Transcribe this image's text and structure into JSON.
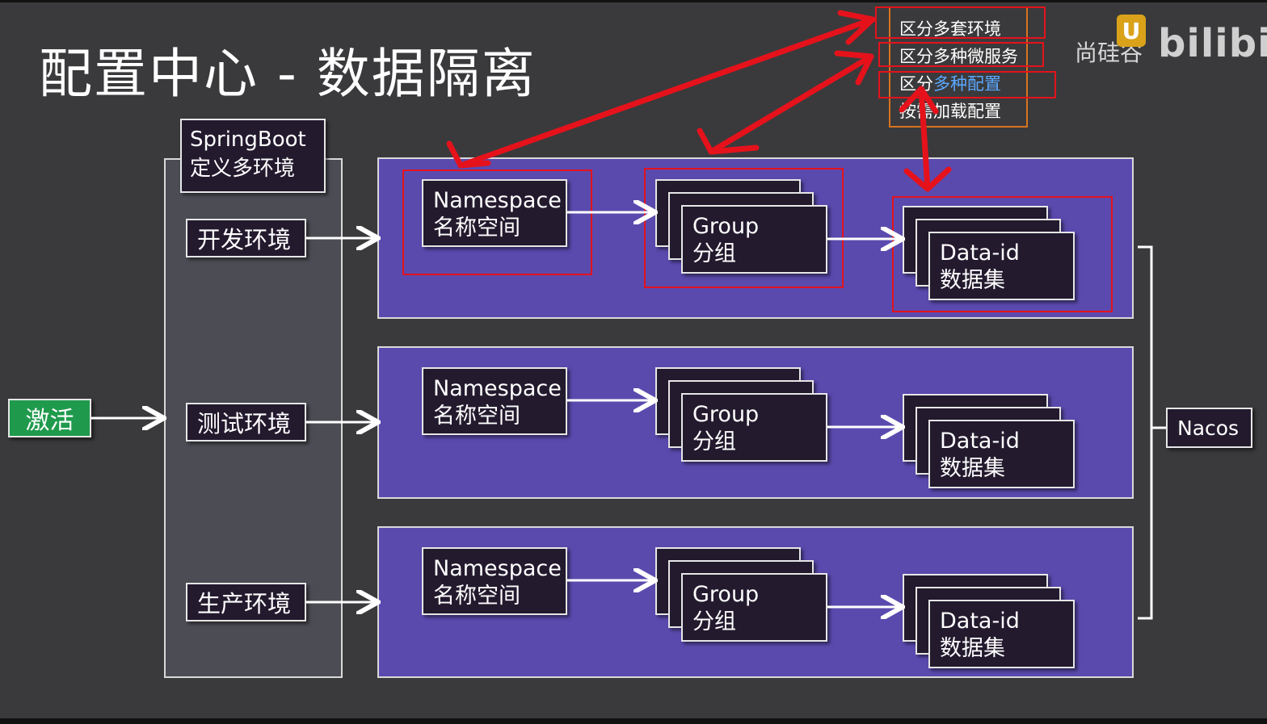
{
  "title": "配置中心 - 数据隔离",
  "springboot": {
    "line1": "SpringBoot",
    "line2": "定义多环境"
  },
  "environments": [
    "开发环境",
    "测试环境",
    "生产环境"
  ],
  "activate": "激活",
  "namespace": {
    "en": "Namespace",
    "zh": "名称空间"
  },
  "group": {
    "en": "Group",
    "zh": "分组"
  },
  "dataid": {
    "en": "Data-id",
    "zh": "数据集"
  },
  "nacos": "Nacos",
  "features": {
    "f1": "区分多套环境",
    "f2": "区分多种微服务",
    "f3_prefix": "区分",
    "f3_highlight": "多种配置",
    "f4": "按需加载配置"
  },
  "watermark": {
    "org": "尚硅谷",
    "site": "bilibili"
  },
  "colors": {
    "panel": "#5b4aae",
    "dark_box": "#231a2e",
    "activate": "#1f9a4c",
    "red": "#e5121b",
    "highlight": "#5aa8ff"
  }
}
